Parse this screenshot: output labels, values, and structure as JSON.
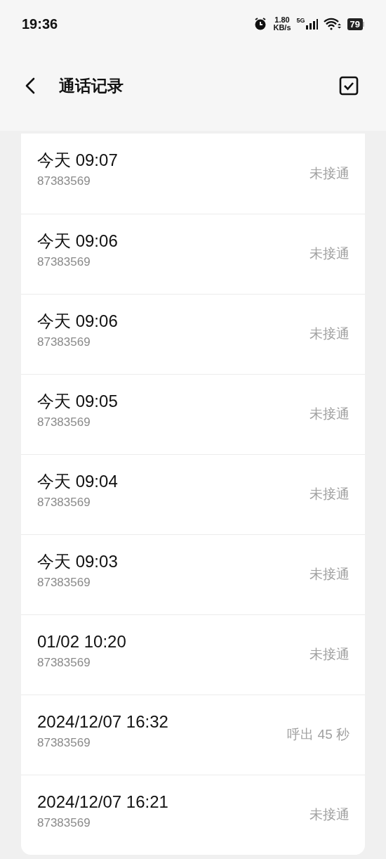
{
  "status_bar": {
    "time": "19:36",
    "speed_value": "1.80",
    "speed_unit": "KB/s",
    "network": "5G",
    "battery": "79"
  },
  "header": {
    "title": "通话记录"
  },
  "calls": [
    {
      "time": "今天 09:07",
      "number": "87383569",
      "status": "未接通"
    },
    {
      "time": "今天 09:06",
      "number": "87383569",
      "status": "未接通"
    },
    {
      "time": "今天 09:06",
      "number": "87383569",
      "status": "未接通"
    },
    {
      "time": "今天 09:05",
      "number": "87383569",
      "status": "未接通"
    },
    {
      "time": "今天 09:04",
      "number": "87383569",
      "status": "未接通"
    },
    {
      "time": "今天 09:03",
      "number": "87383569",
      "status": "未接通"
    },
    {
      "time": "01/02 10:20",
      "number": "87383569",
      "status": "未接通"
    },
    {
      "time": "2024/12/07 16:32",
      "number": "87383569",
      "status": "呼出 45 秒"
    },
    {
      "time": "2024/12/07 16:21",
      "number": "87383569",
      "status": "未接通"
    }
  ]
}
